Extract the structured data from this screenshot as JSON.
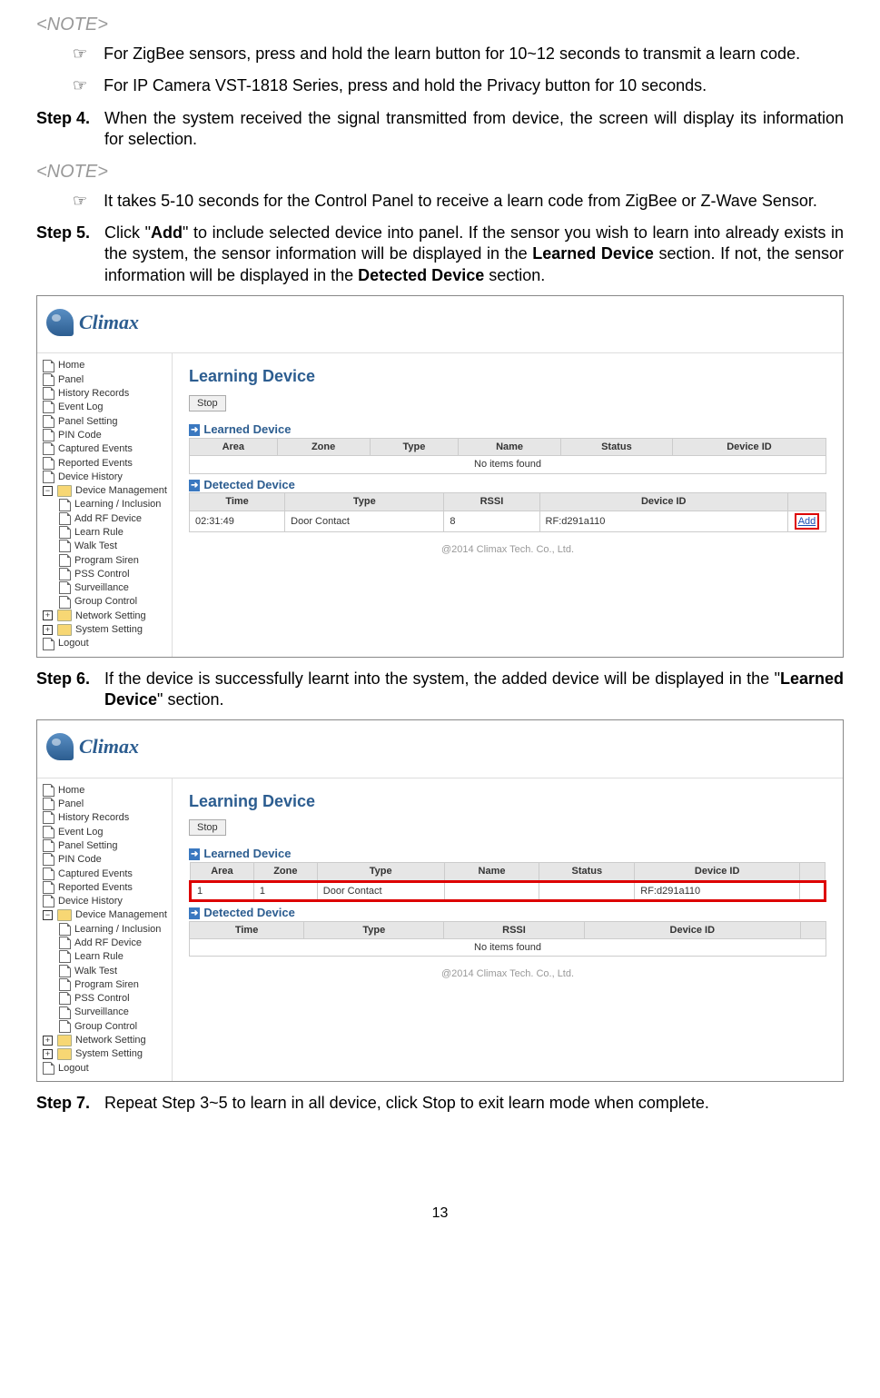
{
  "note_label": "<NOTE>",
  "bullets": {
    "b1": "For ZigBee sensors, press and hold the learn button for 10~12 seconds to transmit a learn code.",
    "b2": "For IP Camera VST-1818 Series, press and hold the Privacy button for 10 seconds.",
    "b3": "It takes 5-10 seconds for the Control Panel to receive a learn code from ZigBee or Z-Wave Sensor."
  },
  "steps": {
    "s4_num": "Step 4.",
    "s4": "When the system received the signal transmitted from device, the screen will display its information for selection.",
    "s5_num": "Step 5.",
    "s5_a": "Click \"",
    "s5_add": "Add",
    "s5_b": "\" to include selected device into panel. If the sensor you wish to learn into already exists in the system, the sensor information will be displayed in the ",
    "s5_learned": "Learned Device",
    "s5_c": " section. If not, the sensor information will be displayed in the ",
    "s5_detected": "Detected Device",
    "s5_d": " section.",
    "s6_num": "Step 6.",
    "s6_a": "If the device is successfully learnt into the system, the added device will be displayed in the \"",
    "s6_learned": "Learned Device",
    "s6_b": "\" section.",
    "s7_num": "Step 7.",
    "s7": "Repeat Step 3~5 to learn in all device, click Stop to exit learn mode when complete."
  },
  "ui": {
    "brand": "Climax",
    "title": "Learning Device",
    "stop_btn": "Stop",
    "section_learned": "Learned Device",
    "section_detected": "Detected Device",
    "no_items": "No items found",
    "footer": "@2014 Climax Tech. Co., Ltd.",
    "add_link": "Add",
    "nav": [
      "Home",
      "Panel",
      "History Records",
      "Event Log",
      "Panel Setting",
      "PIN Code",
      "Captured Events",
      "Reported Events",
      "Device History",
      "Device Management",
      "Learning / Inclusion",
      "Add RF Device",
      "Learn Rule",
      "Walk Test",
      "Program Siren",
      "PSS Control",
      "Surveillance",
      "Group Control",
      "Network Setting",
      "System Setting",
      "Logout"
    ],
    "headers_learned": [
      "Area",
      "Zone",
      "Type",
      "Name",
      "Status",
      "Device ID"
    ],
    "headers_detected": [
      "Time",
      "Type",
      "RSSI",
      "Device ID"
    ],
    "detected_row": {
      "time": "02:31:49",
      "type": "Door Contact",
      "rssi": "8",
      "device_id": "RF:d291a110"
    },
    "learned_row": {
      "area": "1",
      "zone": "1",
      "type": "Door Contact",
      "name": "",
      "status": "",
      "device_id": "RF:d291a110"
    }
  },
  "page_number": "13"
}
